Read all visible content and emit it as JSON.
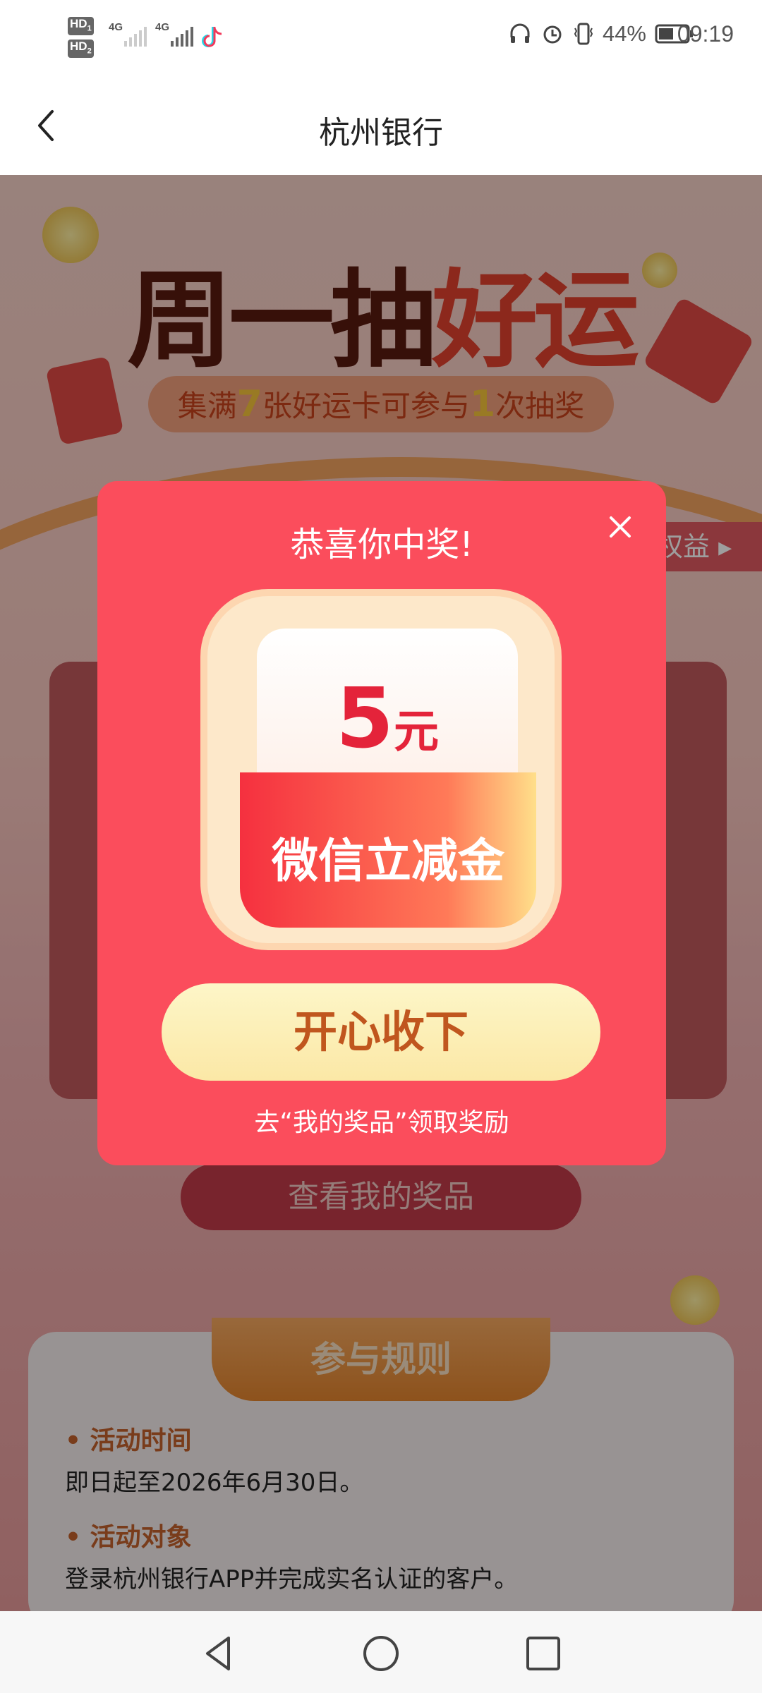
{
  "status_bar": {
    "sim1_hd": "HD",
    "sim1_index": "1",
    "sim2_hd": "HD",
    "sim2_index": "2",
    "network1": "4G",
    "network2": "4G",
    "battery": "44%",
    "time": "09:19"
  },
  "header": {
    "title": "杭州银行"
  },
  "background": {
    "hero_title_dark": "周一抽",
    "hero_title_red": "好运",
    "pill_part1": "集满",
    "pill_num1": "7",
    "pill_part2": "张好运卡可参与",
    "pill_num2": "1",
    "pill_part3": "次抽奖",
    "side_tag": "权益",
    "view_prizes_button": "查看我的奖品",
    "rules_title": "参与规则",
    "rules": [
      {
        "heading": "活动时间",
        "text": "即日起至2026年6月30日。"
      },
      {
        "heading": "活动对象",
        "text": "登录杭州银行APP并完成实名认证的客户。"
      }
    ]
  },
  "modal": {
    "title": "恭喜你中奖!",
    "prize_amount": "5",
    "prize_unit": "元",
    "prize_name": "微信立减金",
    "accept_button": "开心收下",
    "hint": "去“我的奖品”领取奖励"
  },
  "colors": {
    "modal_bg": "#fb4d5c",
    "accept_text": "#c0561e",
    "prize_red": "#e4233a"
  }
}
